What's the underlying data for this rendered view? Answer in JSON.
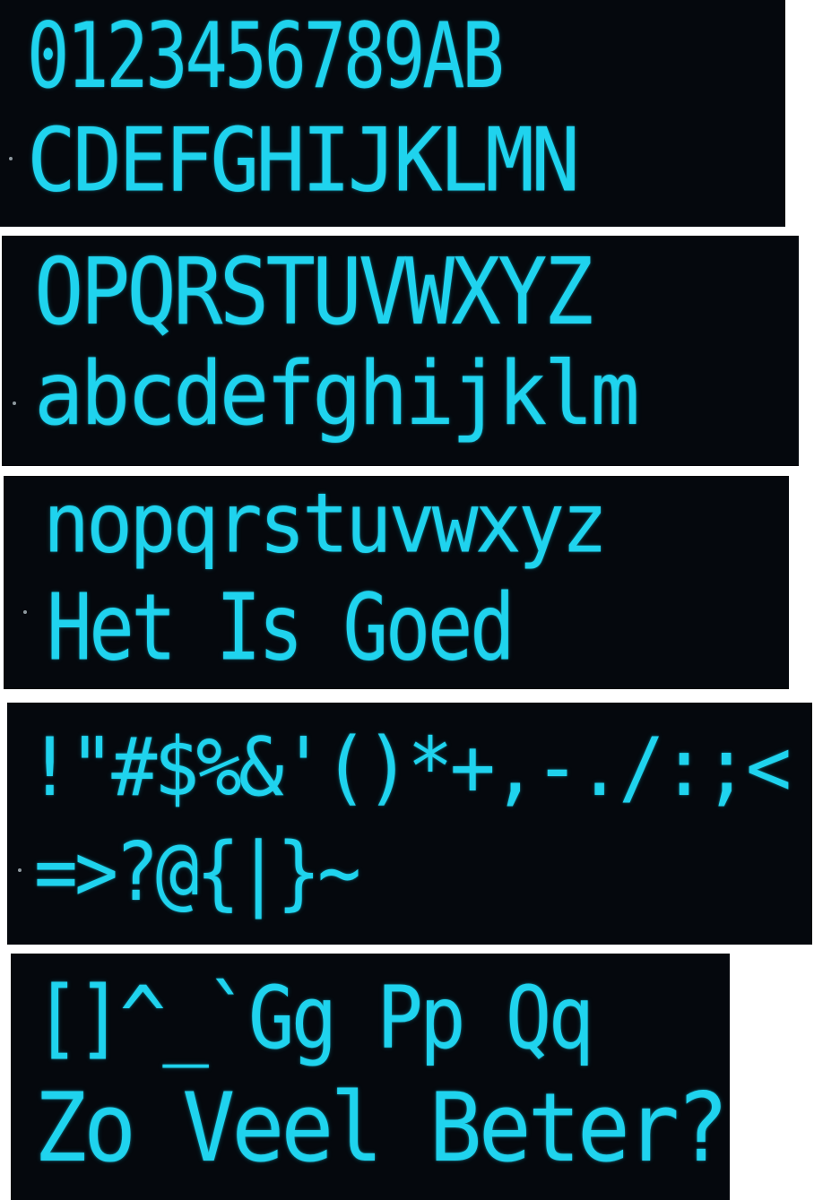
{
  "panels": [
    {
      "line1": "0123456789AB",
      "line2": "CDEFGHIJKLMN"
    },
    {
      "line1": "OPQRSTUVWXYZ",
      "line2": "abcdefghijklm"
    },
    {
      "line1": "nopqrstuvwxyz",
      "line2": "Het Is Goed"
    },
    {
      "line1": "!\"#$%&'()*+,-./:;<",
      "line2": "=>?@{|}~"
    },
    {
      "line1": "[]^_`Gg Pp Qq",
      "line2": "Zo Veel Beter?"
    }
  ],
  "colors": {
    "display_background": "#05080d",
    "display_text": "#1fd3ee",
    "page_background": "#ffffff"
  }
}
